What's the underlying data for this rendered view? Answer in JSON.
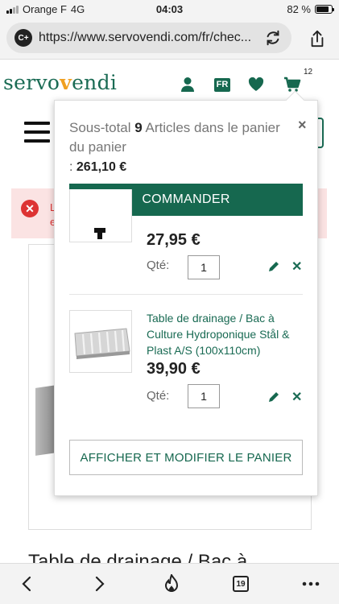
{
  "status_bar": {
    "carrier": "Orange F",
    "network": "4G",
    "time": "04:03",
    "battery_text": "82 %",
    "battery_level": 0.82
  },
  "browser": {
    "url": "https://www.servovendi.com/fr/chec...",
    "site_icon_text": "C+",
    "tabs_count": "19"
  },
  "header": {
    "logo_left": "servo",
    "logo_v": "v",
    "logo_right": "endi",
    "lang": "FR",
    "cart_count": "12"
  },
  "background_page": {
    "error_fragment_1": "L",
    "error_fragment_2": "e",
    "product_title": "Table de drainage / Bac à"
  },
  "minicart": {
    "close_label": "×",
    "subtotal_label": "Sous-total",
    "items_count": "9",
    "items_text": "Articles dans le panier",
    "subtotal_label_2": "du panier",
    "subtotal_colon": ":",
    "subtotal_amount": "261,10 €",
    "checkout_label": "COMMANDER",
    "qty_label": "Qté:",
    "items": [
      {
        "name": "",
        "price": "27,95 €",
        "qty": "1"
      },
      {
        "name": "Table de drainage / Bac à Culture Hydroponique Stål & Plast A/S (100x110cm)",
        "price": "39,90 €",
        "qty": "1"
      }
    ],
    "view_cart_label": "AFFICHER ET MODIFIER LE PANIER"
  },
  "colors": {
    "brand_green": "#16684f",
    "accent_orange": "#f0a020",
    "error_red": "#dd3333"
  }
}
